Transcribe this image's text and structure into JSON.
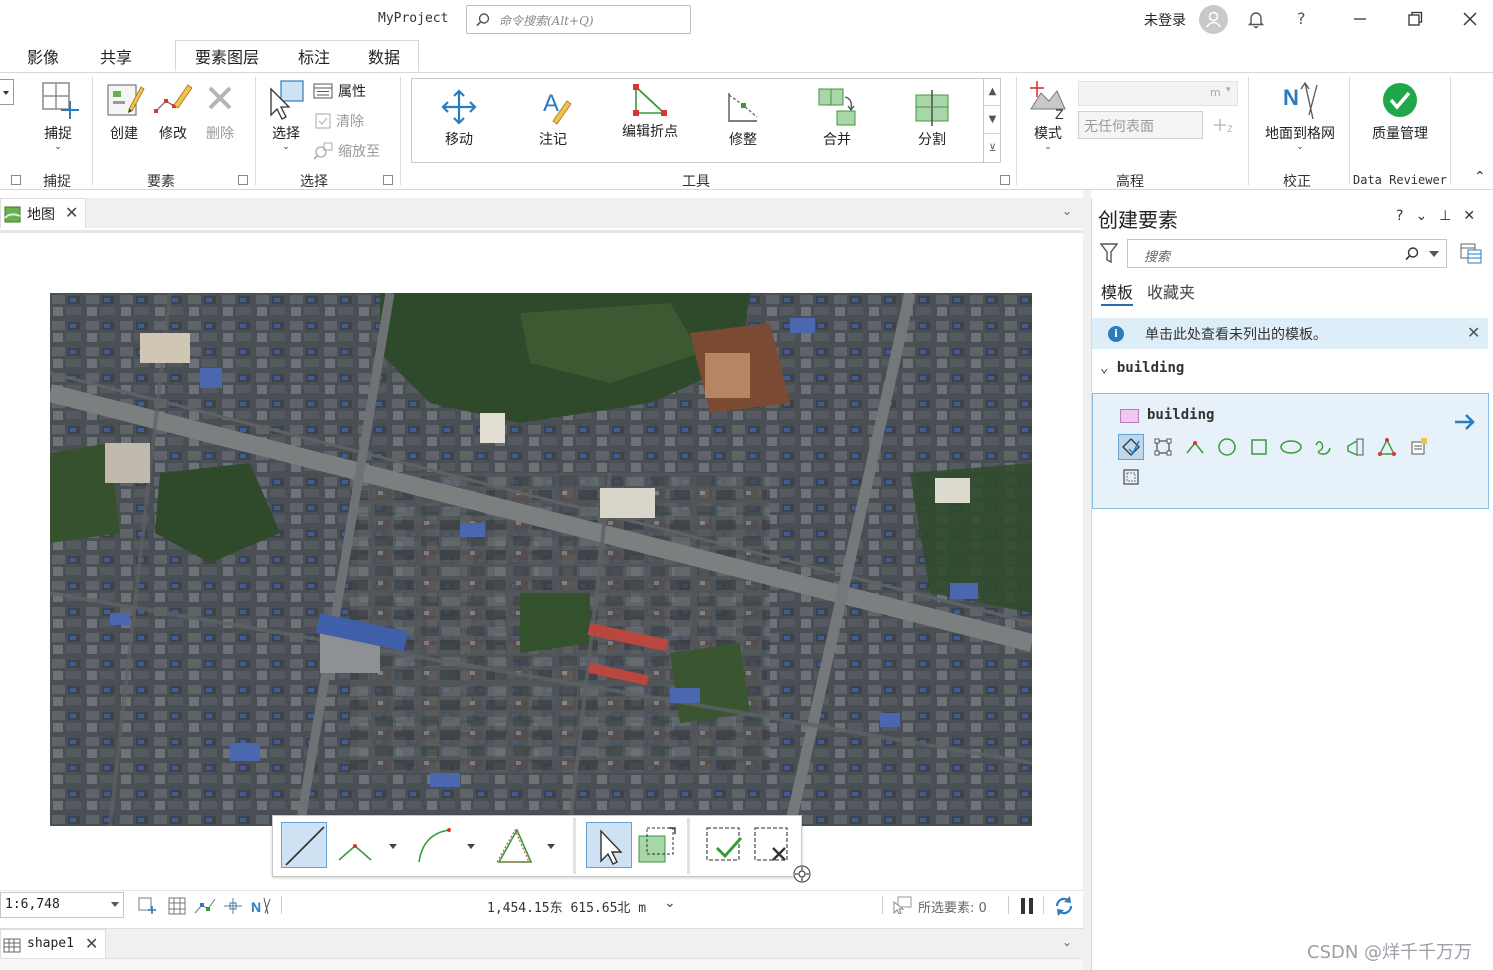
{
  "titlebar": {
    "project": "MyProject",
    "search_placeholder": "命令搜索(Alt+Q)",
    "login": "未登录"
  },
  "menu": {
    "tabs": [
      "影像",
      "共享",
      "要素图层",
      "标注",
      "数据"
    ]
  },
  "ribbon": {
    "snap": {
      "button": "捕捉",
      "group": "捕捉"
    },
    "features": {
      "create": "创建",
      "modify": "修改",
      "delete": "删除",
      "group": "要素"
    },
    "selection": {
      "select": "选择",
      "attributes": "属性",
      "clear": "清除",
      "zoom_to": "缩放至",
      "group": "选择"
    },
    "tools": {
      "move": "移动",
      "annotate": "注记",
      "edit_vertices": "编辑折点",
      "reshape": "修整",
      "merge": "合并",
      "split": "分割",
      "group": "工具"
    },
    "elevation": {
      "mode": "模式",
      "unit": "m",
      "surface": "无任何表面",
      "group": "高程"
    },
    "correction": {
      "ground_to_grid": "地面到格网",
      "group": "校正"
    },
    "reviewer": {
      "quality": "质量管理",
      "group": "Data Reviewer"
    }
  },
  "map": {
    "tab_label": "地图",
    "scale": "1:6,748",
    "coordinates": "1,454.15东 615.65北 m",
    "selected_features": "所选要素: 0"
  },
  "table": {
    "tab_label": "shape1"
  },
  "create_features": {
    "title": "创建要素",
    "controls": [
      "?",
      "⌄",
      "⊥",
      "✕"
    ],
    "search_placeholder": "搜索",
    "tabs": {
      "templates": "模板",
      "favorites": "收藏夹"
    },
    "info_message": "单击此处查看未列出的模板。",
    "group_name": "building",
    "template_name": "building"
  },
  "watermark": "CSDN @烊千千万万",
  "colors": {
    "accent": "#2b7bbf",
    "template_card_bg": "#e6f1f9",
    "template_card_border": "#8cc0e3",
    "info_bar_bg": "#ddeef8",
    "swatch_fill": "#f1c9f0",
    "reviewer_green": "#1fa84a",
    "tool_green": "#3a9a3a",
    "selected_tool_bg": "#cfe2f3"
  }
}
